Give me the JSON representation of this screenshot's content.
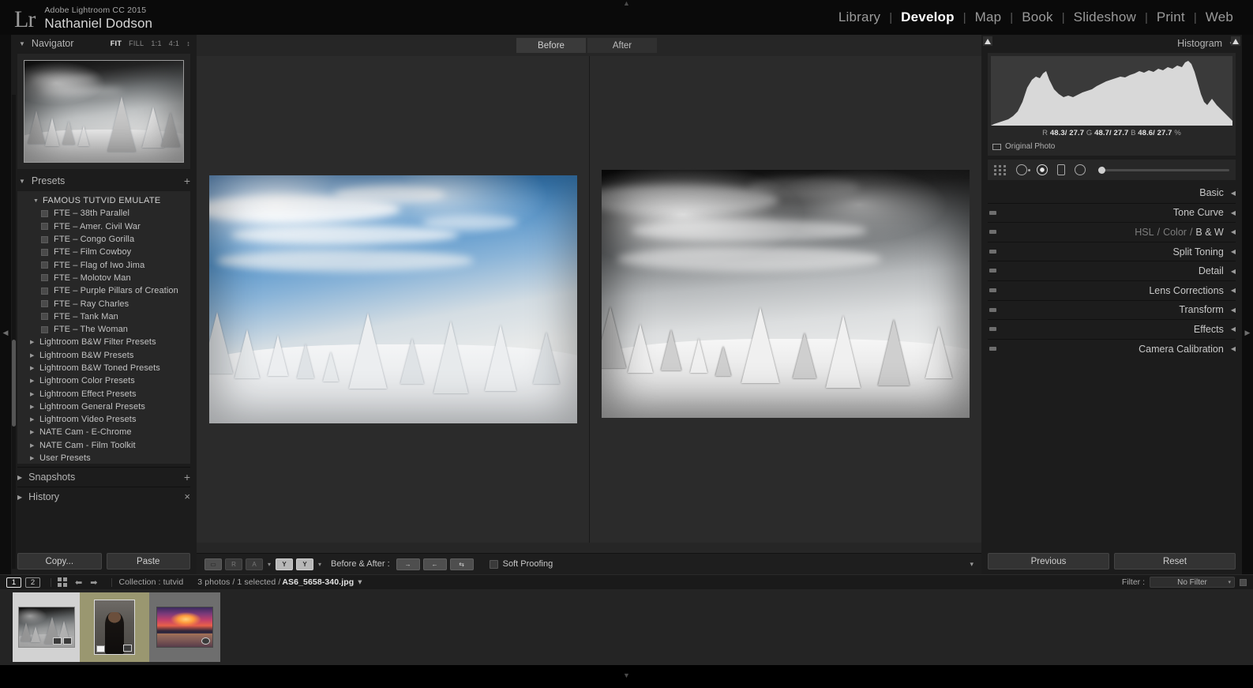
{
  "app": {
    "product": "Adobe Lightroom CC 2015",
    "user": "Nathaniel Dodson",
    "logo": "Lr"
  },
  "modules": [
    {
      "label": "Library",
      "active": false
    },
    {
      "label": "Develop",
      "active": true
    },
    {
      "label": "Map",
      "active": false
    },
    {
      "label": "Book",
      "active": false
    },
    {
      "label": "Slideshow",
      "active": false
    },
    {
      "label": "Print",
      "active": false
    },
    {
      "label": "Web",
      "active": false
    }
  ],
  "module_separator": "|",
  "left_panel": {
    "navigator": {
      "title": "Navigator",
      "zoom_levels": [
        {
          "label": "FIT",
          "active": true
        },
        {
          "label": "FILL",
          "active": false
        },
        {
          "label": "1:1",
          "active": false
        },
        {
          "label": "4:1",
          "active": false
        }
      ],
      "stepper": "↕"
    },
    "presets": {
      "title": "Presets",
      "add_label": "+",
      "groups": [
        {
          "name": "FAMOUS TUTVID EMULATE",
          "expanded": true,
          "items": [
            "FTE – 38th Parallel",
            "FTE – Amer. Civil War",
            "FTE – Congo Gorilla",
            "FTE – Film Cowboy",
            "FTE – Flag of Iwo Jima",
            "FTE – Molotov Man",
            "FTE – Purple Pillars of Creation",
            "FTE – Ray Charles",
            "FTE – Tank Man",
            "FTE – The Woman"
          ]
        }
      ],
      "folders": [
        "Lightroom B&W Filter Presets",
        "Lightroom B&W Presets",
        "Lightroom B&W Toned Presets",
        "Lightroom Color Presets",
        "Lightroom Effect Presets",
        "Lightroom General Presets",
        "Lightroom Video Presets",
        "NATE Cam - E-Chrome",
        "NATE Cam - Film Toolkit",
        "User Presets"
      ]
    },
    "snapshots": {
      "title": "Snapshots",
      "add_label": "+"
    },
    "history": {
      "title": "History",
      "clear_label": "×"
    },
    "copy_button": "Copy...",
    "paste_button": "Paste"
  },
  "center": {
    "before_tab": "Before",
    "after_tab": "After",
    "toolbar": {
      "before_after_label": "Before & After :",
      "soft_proofing_label": "Soft Proofing",
      "view_icons": [
        "loupe-view-icon",
        "compare-view-icon",
        "survey-view-icon",
        "reference-view-icon"
      ],
      "ba_mode_icons": [
        "before-after-left-right-icon",
        "before-after-left-right-split-icon",
        "before-after-top-bottom-icon"
      ]
    }
  },
  "right_panel": {
    "histogram": {
      "title": "Histogram",
      "collapse_icon": "▼",
      "readout_prefix_r": "R",
      "readout_r": "48.3/ 27.7",
      "readout_prefix_g": "G",
      "readout_g": "48.7/ 27.7",
      "readout_prefix_b": "B",
      "readout_b": "48.6/ 27.7",
      "readout_unit": "%",
      "original_photo_label": "Original Photo"
    },
    "tools": [
      "crop-overlay-icon",
      "spot-removal-icon",
      "red-eye-correction-icon",
      "graduated-filter-icon",
      "radial-filter-icon",
      "adjustment-slider"
    ],
    "sections": [
      {
        "label": "Basic",
        "switch": false
      },
      {
        "label": "Tone Curve",
        "switch": true
      },
      {
        "label": "HSL / Color / B & W",
        "switch": true,
        "parts": [
          "HSL",
          "Color",
          "B & W"
        ]
      },
      {
        "label": "Split Toning",
        "switch": true
      },
      {
        "label": "Detail",
        "switch": true
      },
      {
        "label": "Lens Corrections",
        "switch": true
      },
      {
        "label": "Transform",
        "switch": true
      },
      {
        "label": "Effects",
        "switch": true
      },
      {
        "label": "Camera Calibration",
        "switch": true
      }
    ],
    "previous_button": "Previous",
    "reset_button": "Reset"
  },
  "filmstrip_bar": {
    "screen_1": "1",
    "screen_2": "2",
    "collection_label": "Collection : tutvid",
    "photo_count": "3 photos / 1 selected /",
    "filename": "AS6_5658-340.jpg",
    "filename_caret": "▾",
    "filter_label": "Filter :",
    "filter_value": "No Filter"
  },
  "filmstrip": {
    "items": [
      {
        "name": "snowy-trees-bw-thumbnail",
        "selected": false
      },
      {
        "name": "woman-portrait-thumbnail",
        "selected": true
      },
      {
        "name": "sunset-cityscape-thumbnail",
        "selected": false
      }
    ]
  }
}
